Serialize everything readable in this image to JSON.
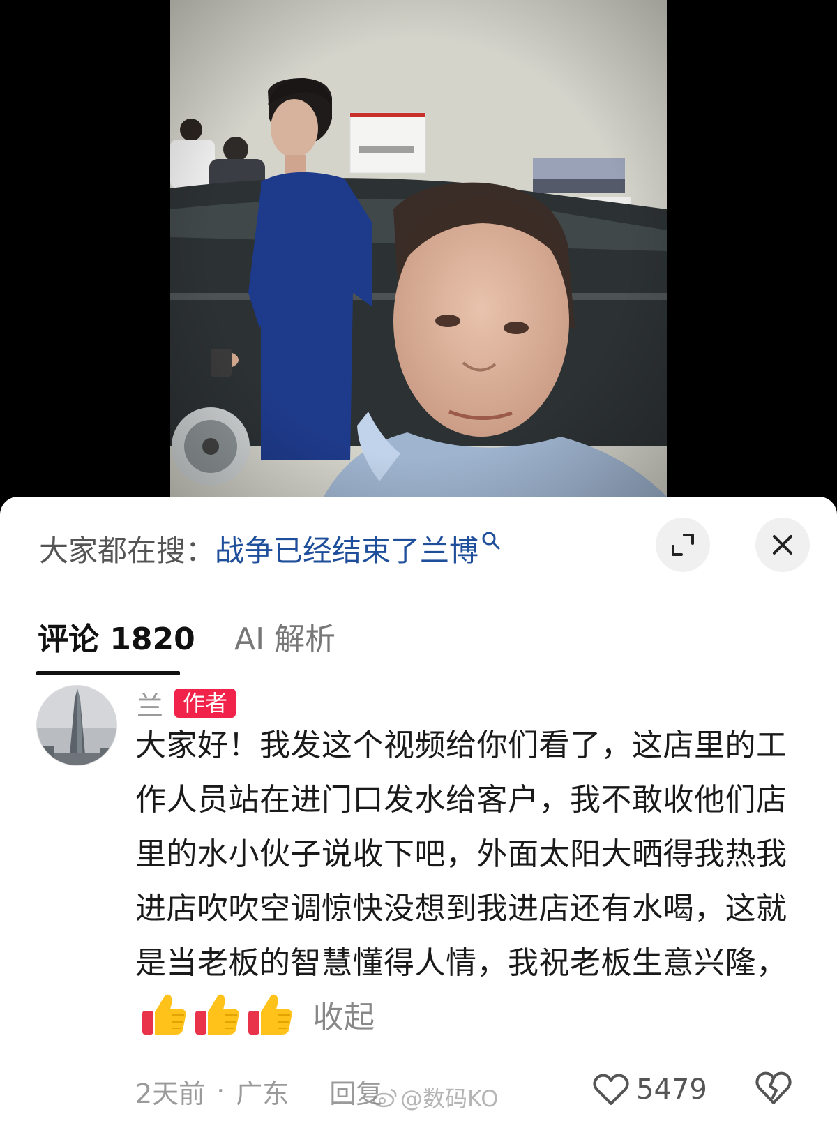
{
  "search": {
    "prefix": "大家都在搜：",
    "query": "战争已经结束了兰博",
    "icon": "search-icon"
  },
  "header_buttons": {
    "expand_icon": "expand-icon",
    "close_icon": "close-icon"
  },
  "tabs": [
    {
      "label": "评论 1820",
      "active": true
    },
    {
      "label": "AI 解析",
      "active": false
    }
  ],
  "comment": {
    "author": "兰",
    "badge": "作者",
    "text": "大家好！我发这个视频给你们看了，这店里的工作人员站在进门口发水给客户，我不敢收他们店里的水小伙子说收下吧，外面太阳大晒得我热我进店吹吹空调惊快没想到我进店还有水喝，这就是当老板的智慧懂得人情，我祝老板生意兴隆，",
    "emoji": [
      "thumbs-up-icon",
      "thumbs-up-icon",
      "thumbs-up-icon"
    ],
    "collapse_label": "收起",
    "time": "2天前",
    "separator": "·",
    "location": "广东",
    "reply_label": "回复",
    "likes": "5479"
  },
  "watermark": "@数码KO",
  "colors": {
    "link": "#1f4e9a",
    "badge": "#f2234b",
    "muted": "#9a9a9a",
    "text": "#1a1a1a"
  }
}
